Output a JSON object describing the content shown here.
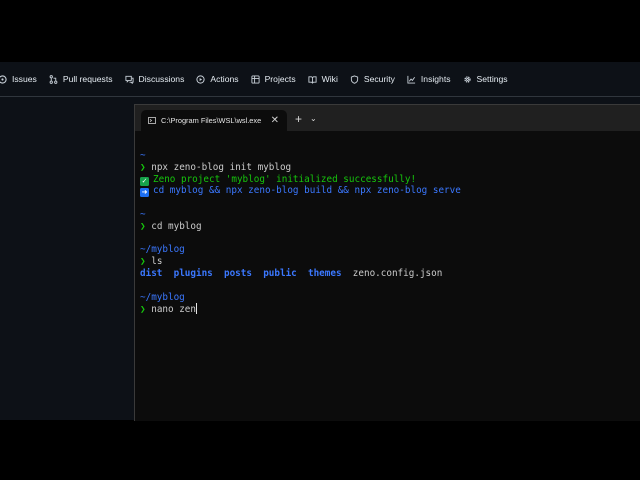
{
  "github_nav": {
    "items": [
      {
        "label": "Issues",
        "icon": "issue-icon"
      },
      {
        "label": "Pull requests",
        "icon": "pull-request-icon"
      },
      {
        "label": "Discussions",
        "icon": "discussion-icon"
      },
      {
        "label": "Actions",
        "icon": "actions-icon"
      },
      {
        "label": "Projects",
        "icon": "projects-icon"
      },
      {
        "label": "Wiki",
        "icon": "wiki-icon"
      },
      {
        "label": "Security",
        "icon": "shield-icon"
      },
      {
        "label": "Insights",
        "icon": "graph-icon"
      },
      {
        "label": "Settings",
        "icon": "gear-icon"
      }
    ]
  },
  "terminal": {
    "tab_title": "C:\\Program Files\\WSL\\wsl.exe",
    "new_tab_label": "+",
    "dropdown_label": "⌄",
    "close_label": "✕",
    "colors": {
      "prompt": "#16c60c",
      "path": "#3b78ff",
      "text": "#cccccc"
    },
    "lines": {
      "l1_path": "~",
      "l2_prompt": "❯",
      "l2_cmd": "npx zeno-blog init myblog",
      "l3_success": "Zeno project 'myblog' initialized successfully!",
      "l4_hint": "cd myblog && npx zeno-blog build && npx zeno-blog serve",
      "l6_path": "~",
      "l7_prompt": "❯",
      "l7_cmd": "cd myblog",
      "l9_path": "~/myblog",
      "l10_prompt": "❯",
      "l10_cmd": "ls",
      "ls_dirs": [
        "dist",
        "plugins",
        "posts",
        "public",
        "themes"
      ],
      "ls_file": "zeno.config.json",
      "l13_path": "~/myblog",
      "l14_prompt": "❯",
      "l14_cmd": "nano zen"
    }
  }
}
